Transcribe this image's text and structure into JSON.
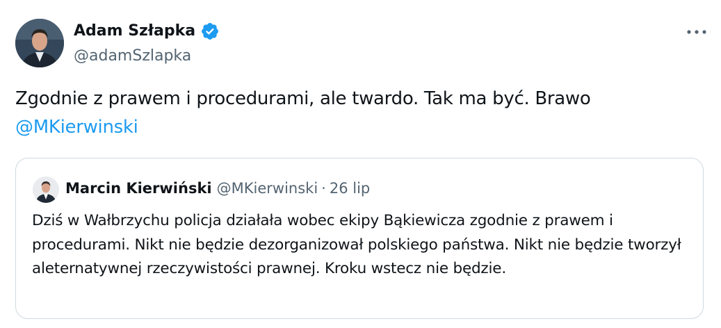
{
  "tweet": {
    "author": {
      "name": "Adam Szłapka",
      "handle": "@adamSzlapka",
      "verified": true,
      "verified_color": "#1d9bf0"
    },
    "more_icon": "more-horizontal-icon",
    "text": "Zgodnie z prawem i procedurami, ale twardo. Tak ma być. Brawo",
    "mention": "@MKierwinski",
    "mention_color": "#1d9bf0"
  },
  "quote": {
    "author": {
      "name": "Marcin Kierwiński",
      "handle": "@MKierwinski"
    },
    "separator": "·",
    "date": "26 lip",
    "text": "Dziś w Wałbrzychu policja działała wobec ekipy Bąkiewicza zgodnie z prawem i procedurami. Nikt nie będzie dezorganizował polskiego państwa. Nikt nie będzie tworzył aleternatywnej rzeczywistości prawnej. Kroku wstecz nie będzie."
  }
}
